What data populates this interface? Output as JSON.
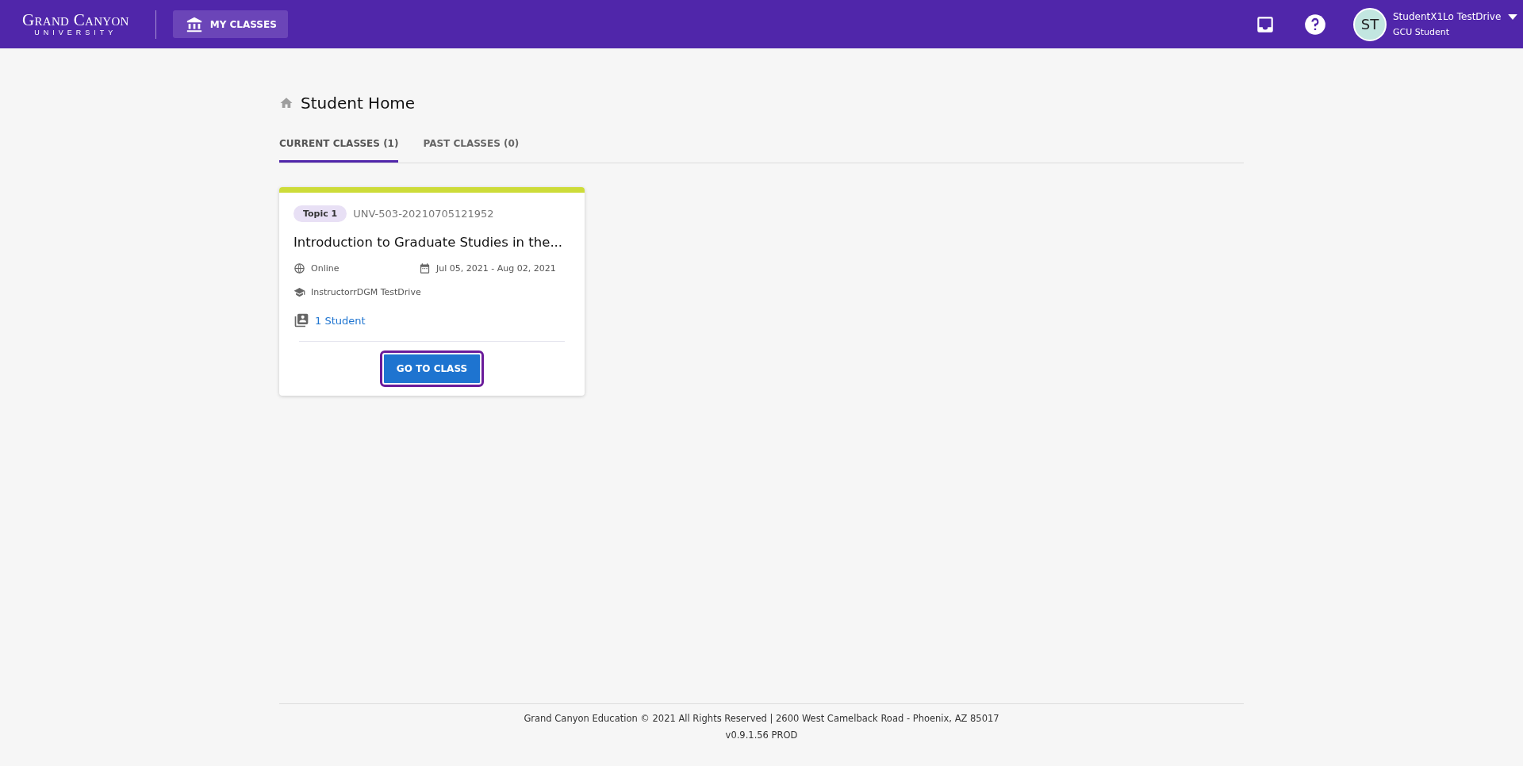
{
  "header": {
    "logo": {
      "name": "Grand Canyon",
      "sub": "UNIVERSITY"
    },
    "nav_button": "MY CLASSES",
    "user": {
      "initials": "ST",
      "name": "StudentX1Lo TestDrive",
      "role": "GCU Student"
    }
  },
  "page": {
    "title": "Student Home"
  },
  "tabs": [
    {
      "label": "CURRENT CLASSES (1)",
      "selected": true
    },
    {
      "label": "PAST CLASSES (0)",
      "selected": false
    }
  ],
  "classes": [
    {
      "color": "#cddc39",
      "topic": "Topic 1",
      "code": "UNV-503-20210705121952",
      "title": "Introduction to Graduate Studies in the...",
      "modality": "Online",
      "dates": "Jul 05, 2021 - Aug 02, 2021",
      "instructor": "InstructorrDGM TestDrive",
      "students": "1 Student",
      "button": "GO TO CLASS"
    }
  ],
  "footer": {
    "copyright": "Grand Canyon Education © 2021 All Rights Reserved | 2600 West Camelback Road - Phoenix, AZ 85017",
    "version": "v0.9.1.56 PROD"
  }
}
